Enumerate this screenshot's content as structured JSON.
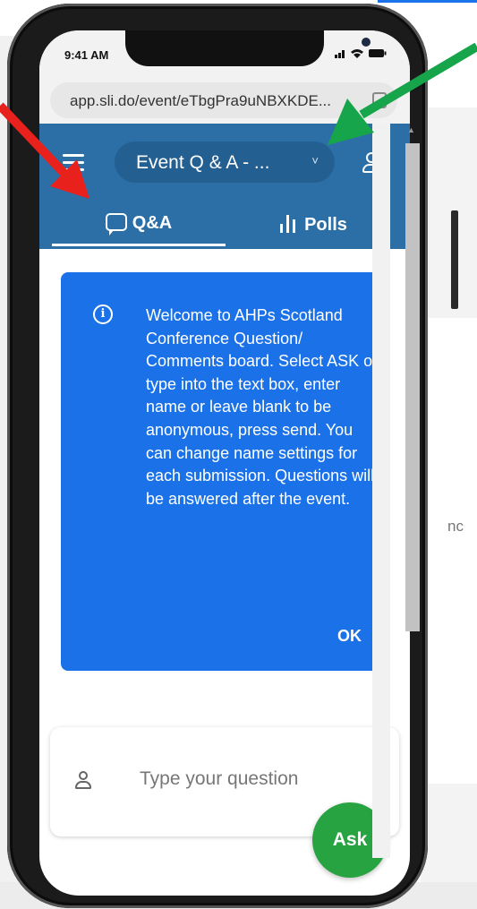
{
  "status_bar": {
    "time": "9:41 AM",
    "icons": "∷ ≈ ▬"
  },
  "browser": {
    "url": "app.sli.do/event/eTbgPra9uNBXKDE..."
  },
  "header": {
    "event_title": "Event Q & A - ...",
    "chevron": "˅",
    "tabs": [
      {
        "label": "Q&A",
        "active": true
      },
      {
        "label": "Polls",
        "active": false
      }
    ]
  },
  "welcome_card": {
    "info_icon": "i",
    "message": "Welcome to AHPs Scotland Conference Question/ Comments board. Select ASK or type into the text box, enter name or leave blank to be anonymous, press send. You can change name settings for each submission. Questions will be answered after the event.",
    "ok_label": "OK"
  },
  "question_input": {
    "placeholder": "Type your question"
  },
  "ask_button": {
    "label": "Ask"
  },
  "background": {
    "partial_text": "nc"
  },
  "colors": {
    "header_bg": "#2c6ea6",
    "card_bg": "#1b72e8",
    "ask_bg": "#27a441",
    "red_arrow": "#e8211d",
    "green_arrow": "#16a54a"
  },
  "icons": [
    "hamburger-icon",
    "chevron-down-icon",
    "user-icon",
    "chat-icon",
    "bar-chart-icon",
    "info-icon",
    "copy-icon"
  ]
}
